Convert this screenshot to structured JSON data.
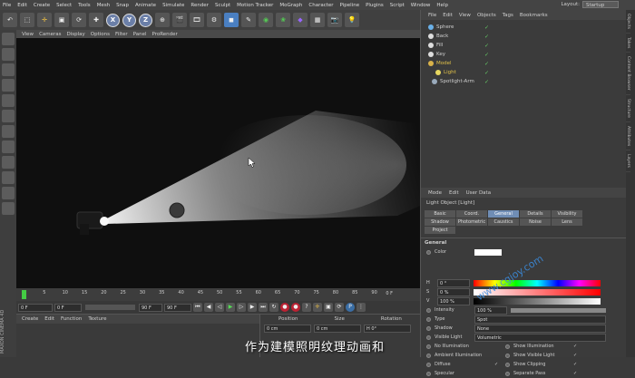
{
  "menubar": [
    "File",
    "Edit",
    "Create",
    "Select",
    "Tools",
    "Mesh",
    "Snap",
    "Animate",
    "Simulate",
    "Render",
    "Sculpt",
    "Motion Tracker",
    "MoGraph",
    "Character",
    "Pipeline",
    "Plugins",
    "Script",
    "Window",
    "Help"
  ],
  "layout": {
    "label": "Layout:",
    "value": "Startup"
  },
  "viewport_menu": [
    "View",
    "Cameras",
    "Display",
    "Options",
    "Filter",
    "Panel",
    "ProRender"
  ],
  "timeline": {
    "ticks": [
      "0",
      "5",
      "10",
      "15",
      "20",
      "25",
      "30",
      "35",
      "40",
      "45",
      "50",
      "55",
      "60",
      "65",
      "70",
      "75",
      "80",
      "85",
      "90"
    ],
    "end_label": "0 F"
  },
  "transport": {
    "start": "0 F",
    "current": "0 F",
    "max": "90 F",
    "end": "90 F"
  },
  "material_menu": [
    "Create",
    "Edit",
    "Function",
    "Texture"
  ],
  "coord": {
    "headers": [
      "Position",
      "Size",
      "Rotation"
    ],
    "x_pos": "0 cm",
    "x_size": "0 cm",
    "x_rot": "H 0°"
  },
  "object_menu": [
    "File",
    "Edit",
    "View",
    "Objects",
    "Tags",
    "Bookmarks"
  ],
  "objects": [
    {
      "name": "Sphere",
      "color": "#6ab0e8"
    },
    {
      "name": "Back",
      "color": "#ddd"
    },
    {
      "name": "Fill",
      "color": "#ddd"
    },
    {
      "name": "Key",
      "color": "#ddd"
    },
    {
      "name": "Model",
      "color": "#d9b24a"
    },
    {
      "name": "Light",
      "color": "#e8d860"
    },
    {
      "name": "Spotlight-Arm",
      "color": "#9ab"
    }
  ],
  "attr_menu": [
    "Mode",
    "Edit",
    "User Data"
  ],
  "attr_title": "Light Object [Light]",
  "attr_tabs": [
    {
      "label": "Basic",
      "active": false
    },
    {
      "label": "Coord.",
      "active": false
    },
    {
      "label": "General",
      "active": true
    },
    {
      "label": "Details",
      "active": false
    },
    {
      "label": "Visibility",
      "active": false
    },
    {
      "label": "Shadow",
      "active": false
    },
    {
      "label": "Photometric",
      "active": false
    },
    {
      "label": "Caustics",
      "active": false
    },
    {
      "label": "Noise",
      "active": false
    },
    {
      "label": "Lens",
      "active": false
    },
    {
      "label": "Project",
      "active": false
    }
  ],
  "general": {
    "section": "General",
    "color_label": "Color",
    "h_label": "H",
    "h_val": "0 °",
    "s_label": "S",
    "s_val": "0 %",
    "v_label": "V",
    "v_val": "100 %",
    "intensity_label": "Intensity",
    "intensity_val": "100 %",
    "type_label": "Type",
    "type_val": "Spot",
    "shadow_label": "Shadow",
    "shadow_val": "None",
    "visible_label": "Visible Light",
    "visible_val": "Volumetric",
    "checks": [
      {
        "a": "No Illumination",
        "b": "Show Illumination"
      },
      {
        "a": "Ambient Illumination",
        "b": "Show Visible Light"
      },
      {
        "a": "Diffuse",
        "b": "Show Clipping"
      },
      {
        "a": "Specular",
        "b": "Separate Pass"
      }
    ]
  },
  "side_tabs": [
    "Objects",
    "Takes",
    "Content Browser",
    "Structure",
    "Attributes",
    "Layers"
  ],
  "subtitle": "作为建模照明纹理动画和",
  "watermark": "www.cgjoy.com",
  "side_logo": "MAXON CINEMA 4D"
}
